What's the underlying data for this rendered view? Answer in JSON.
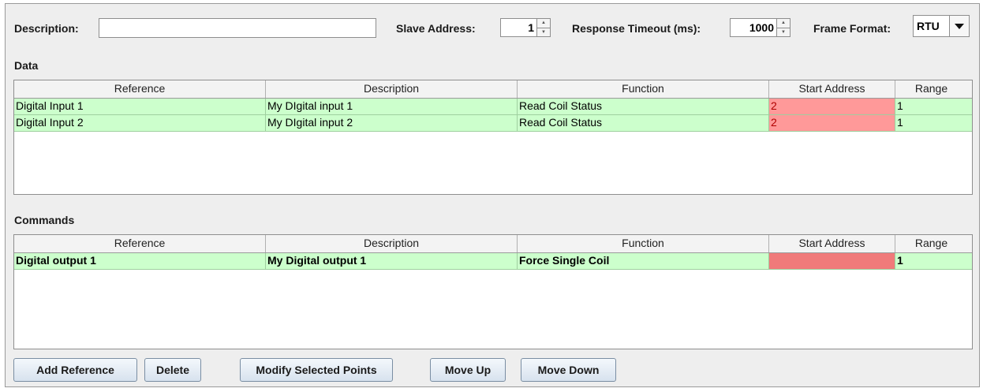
{
  "header": {
    "description_label": "Description:",
    "description_value": "",
    "slave_address_label": "Slave Address:",
    "slave_address_value": "1",
    "timeout_label": "Response Timeout (ms):",
    "timeout_value": "1000",
    "frame_format_label": "Frame Format:",
    "frame_format_value": "RTU"
  },
  "data_section": {
    "title": "Data",
    "columns": [
      "Reference",
      "Description",
      "Function",
      "Start Address",
      "Range"
    ],
    "rows": [
      {
        "reference": "Digital Input 1",
        "description": "My DIgital input 1",
        "function": "Read Coil Status",
        "start_address": "2",
        "range": "1"
      },
      {
        "reference": "Digital Input 2",
        "description": "My DIgital input 2",
        "function": "Read Coil Status",
        "start_address": "2",
        "range": "1"
      }
    ]
  },
  "commands_section": {
    "title": "Commands",
    "columns": [
      "Reference",
      "Description",
      "Function",
      "Start Address",
      "Range"
    ],
    "rows": [
      {
        "reference": "Digital output 1",
        "description": "My Digital output 1",
        "function": "Force Single Coil",
        "start_address": "",
        "range": "1"
      }
    ]
  },
  "buttons": {
    "add_reference": "Add Reference",
    "delete": "Delete",
    "modify_selected": "Modify Selected Points",
    "move_up": "Move Up",
    "move_down": "Move Down"
  },
  "colors": {
    "row_valid": "#ccffcc",
    "cell_invalid": "#ff9999",
    "panel_bg": "#eeeeee"
  }
}
